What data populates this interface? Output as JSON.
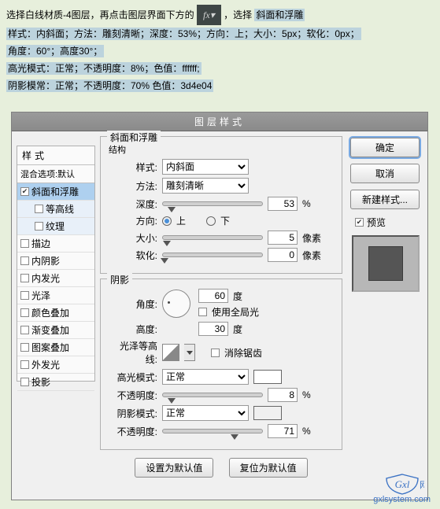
{
  "instr": {
    "line1_a": "选择白线材质-4图层，再点击图层界面下方的",
    "fx": "fx",
    "line1_b": "，选择",
    "line1_c": "斜面和浮雕",
    "line2": "样式：内斜面；方法：雕刻清晰；深度：53%；方向：上；大小：5px；软化：0px；",
    "line3": "角度：60°；高度30°；",
    "line4": "高光模式：正常；不透明度：8%；色值：ffffff;",
    "line5": "阴影模常：正常；不透明度：70%  色值：3d4e04"
  },
  "dialog": {
    "title": "图层样式",
    "left": {
      "head": "样式",
      "blend": "混合选项:默认",
      "items": [
        {
          "label": "斜面和浮雕",
          "checked": true,
          "sel": true
        },
        {
          "label": "等高线",
          "checked": false,
          "sub": true
        },
        {
          "label": "纹理",
          "checked": false,
          "sub": true
        },
        {
          "label": "描边",
          "checked": false
        },
        {
          "label": "内阴影",
          "checked": false
        },
        {
          "label": "内发光",
          "checked": false
        },
        {
          "label": "光泽",
          "checked": false
        },
        {
          "label": "颜色叠加",
          "checked": false
        },
        {
          "label": "渐变叠加",
          "checked": false
        },
        {
          "label": "图案叠加",
          "checked": false
        },
        {
          "label": "外发光",
          "checked": false
        },
        {
          "label": "投影",
          "checked": false
        }
      ]
    },
    "bevel": {
      "legend": "斜面和浮雕",
      "struct": "结构",
      "style_lbl": "样式:",
      "style_val": "内斜面",
      "method_lbl": "方法:",
      "method_val": "雕刻清晰",
      "depth_lbl": "深度:",
      "depth_val": "53",
      "depth_unit": "%",
      "dir_lbl": "方向:",
      "up": "上",
      "down": "下",
      "size_lbl": "大小:",
      "size_val": "5",
      "size_unit": "像素",
      "soft_lbl": "软化:",
      "soft_val": "0",
      "soft_unit": "像素"
    },
    "shading": {
      "legend": "阴影",
      "angle_lbl": "角度:",
      "angle_val": "60",
      "deg": "度",
      "global": "使用全局光",
      "alt_lbl": "高度:",
      "alt_val": "30",
      "gloss_lbl": "光泽等高线:",
      "anti": "消除锯齿",
      "hi_mode_lbl": "高光模式:",
      "hi_mode_val": "正常",
      "hi_op_lbl": "不透明度:",
      "hi_op_val": "8",
      "pct": "%",
      "sh_mode_lbl": "阴影模式:",
      "sh_mode_val": "正常",
      "sh_color": "#3d4e04",
      "sh_op_lbl": "不透明度:",
      "sh_op_val": "71"
    },
    "footer": {
      "default": "设置为默认值",
      "reset": "复位为默认值"
    },
    "right": {
      "ok": "确定",
      "cancel": "取消",
      "newstyle": "新建样式...",
      "preview": "预览"
    }
  },
  "watermark": {
    "brand": "Gxl",
    "suf": "网",
    "url": "gxlsystem.com"
  }
}
